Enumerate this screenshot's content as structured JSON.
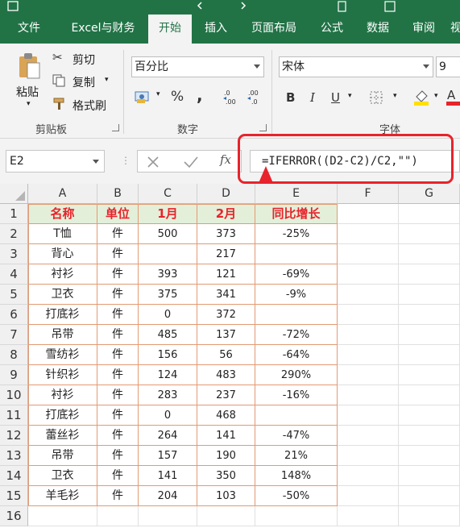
{
  "tabs": [
    "文件",
    "Excel与财务",
    "开始",
    "插入",
    "页面布局",
    "公式",
    "数据",
    "审阅",
    "视"
  ],
  "active_tab": "开始",
  "clipboard": {
    "paste_label": "粘贴",
    "cut_label": "剪切",
    "copy_label": "复制",
    "format_painter_label": "格式刷",
    "group_label": "剪贴板"
  },
  "number": {
    "format_value": "百分比",
    "percent_symbol": "%",
    "comma_symbol": ",",
    "inc_decimal": ".00\n→.0",
    "dec_decimal": ".00\n→.0",
    "group_label": "数字"
  },
  "font": {
    "font_name": "宋体",
    "font_size": "9",
    "bold": "B",
    "italic": "I",
    "underline": "U",
    "font_color_letter": "A",
    "group_label": "字体"
  },
  "formula_bar": {
    "name_box": "E2",
    "fx_symbol": "fx",
    "formula": "=IFERROR((D2-C2)/C2,\"\")"
  },
  "columns": [
    "A",
    "B",
    "C",
    "D",
    "E",
    "F",
    "G"
  ],
  "rows": [
    "1",
    "2",
    "3",
    "4",
    "5",
    "6",
    "7",
    "8",
    "9",
    "10",
    "11",
    "12",
    "13",
    "14",
    "15",
    "16"
  ],
  "table": {
    "headers": [
      "名称",
      "单位",
      "1月",
      "2月",
      "同比增长"
    ],
    "data": [
      [
        "T恤",
        "件",
        "500",
        "373",
        "-25%"
      ],
      [
        "背心",
        "件",
        "",
        "217",
        ""
      ],
      [
        "衬衫",
        "件",
        "393",
        "121",
        "-69%"
      ],
      [
        "卫衣",
        "件",
        "375",
        "341",
        "-9%"
      ],
      [
        "打底衫",
        "件",
        "0",
        "372",
        ""
      ],
      [
        "吊带",
        "件",
        "485",
        "137",
        "-72%"
      ],
      [
        "雪纺衫",
        "件",
        "156",
        "56",
        "-64%"
      ],
      [
        "针织衫",
        "件",
        "124",
        "483",
        "290%"
      ],
      [
        "衬衫",
        "件",
        "283",
        "237",
        "-16%"
      ],
      [
        "打底衫",
        "件",
        "0",
        "468",
        ""
      ],
      [
        "蕾丝衫",
        "件",
        "264",
        "141",
        "-47%"
      ],
      [
        "吊带",
        "件",
        "157",
        "190",
        "21%"
      ],
      [
        "卫衣",
        "件",
        "141",
        "350",
        "148%"
      ],
      [
        "羊毛衫",
        "件",
        "204",
        "103",
        "-50%"
      ]
    ]
  },
  "colors": {
    "excel_green": "#217346",
    "header_fill": "#e3efd9",
    "header_text": "#e8232b",
    "table_border": "#e39a73",
    "annotation_red": "#e8232b"
  }
}
